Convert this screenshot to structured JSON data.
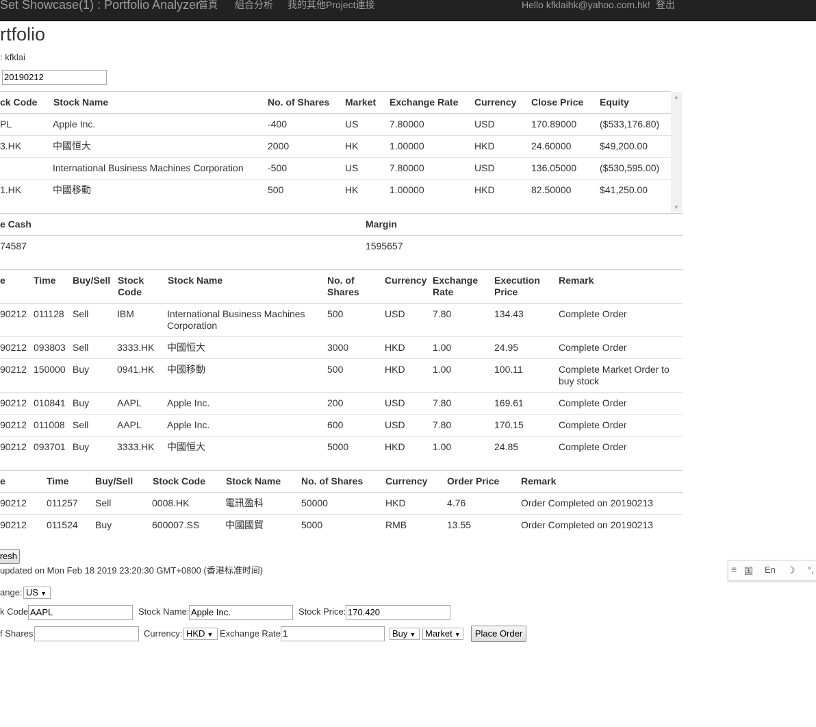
{
  "navbar": {
    "brand": "Set Showcase(1) : Portfolio Analyzer",
    "links": [
      "首頁",
      "組合分析",
      "我的其他Project連接"
    ],
    "user": "Hello kfklaihk@yahoo.com.hk!",
    "logout": "登出"
  },
  "page": {
    "title": "rtfolio",
    "user_line": ": kfklai",
    "date_value": "20190212"
  },
  "holdings": {
    "headers": [
      "ck Code",
      "Stock Name",
      "No. of Shares",
      "Market",
      "Exchange Rate",
      "Currency",
      "Close Price",
      "Equity"
    ],
    "rows": [
      [
        "PL",
        "Apple Inc.",
        "-400",
        "US",
        "7.80000",
        "USD",
        "170.89000",
        "($533,176.80)"
      ],
      [
        "3.HK",
        "中國恒大",
        "2000",
        "HK",
        "1.00000",
        "HKD",
        "24.60000",
        "$49,200.00"
      ],
      [
        "",
        "International Business Machines Corporation",
        "-500",
        "US",
        "7.80000",
        "USD",
        "136.05000",
        "($530,595.00)"
      ],
      [
        "1.HK",
        "中國移動",
        "500",
        "HK",
        "1.00000",
        "HKD",
        "82.50000",
        "$41,250.00"
      ]
    ]
  },
  "cash": {
    "headers": [
      "e Cash",
      "Margin"
    ],
    "values": [
      "74587",
      "1595657"
    ]
  },
  "transactions": {
    "headers": [
      "e",
      "Time",
      "Buy/Sell",
      "Stock Code",
      "Stock Name",
      "No. of Shares",
      "Currency",
      "Exchange Rate",
      "Execution Price",
      "Remark"
    ],
    "rows": [
      [
        "90212",
        "011128",
        "Sell",
        "IBM",
        "International Business Machines Corporation",
        "500",
        "USD",
        "7.80",
        "134.43",
        "Complete Order"
      ],
      [
        "90212",
        "093803",
        "Sell",
        "3333.HK",
        "中國恒大",
        "3000",
        "HKD",
        "1.00",
        "24.95",
        "Complete Order"
      ],
      [
        "90212",
        "150000",
        "Buy",
        "0941.HK",
        "中國移動",
        "500",
        "HKD",
        "1.00",
        "100.11",
        "Complete Market Order to buy stock"
      ],
      [
        "90212",
        "010841",
        "Buy",
        "AAPL",
        "Apple Inc.",
        "200",
        "USD",
        "7.80",
        "169.61",
        "Complete Order"
      ],
      [
        "90212",
        "011008",
        "Sell",
        "AAPL",
        "Apple Inc.",
        "600",
        "USD",
        "7.80",
        "170.15",
        "Complete Order"
      ],
      [
        "90212",
        "093701",
        "Buy",
        "3333.HK",
        "中國恒大",
        "5000",
        "HKD",
        "1.00",
        "24.85",
        "Complete Order"
      ]
    ]
  },
  "orders": {
    "headers": [
      "e",
      "Time",
      "Buy/Sell",
      "Stock Code",
      "Stock Name",
      "No. of Shares",
      "Currency",
      "Order Price",
      "Remark"
    ],
    "rows": [
      [
        "90212",
        "011257",
        "Sell",
        "0008.HK",
        "電訊盈科",
        "50000",
        "HKD",
        "4.76",
        "Order Completed on 20190213"
      ],
      [
        "90212",
        "011524",
        "Buy",
        "600007.SS",
        "中國國貿",
        "5000",
        "RMB",
        "13.55",
        "Order Completed on 20190213"
      ]
    ]
  },
  "refresh": {
    "button": "resh",
    "updated": "updated on Mon Feb 18 2019 23:20:30 GMT+0800 (香港标准时间)"
  },
  "order_form": {
    "exchange_label": "ange:",
    "exchange_value": "US",
    "stock_code_label": "k Code:",
    "stock_code_value": "AAPL",
    "stock_name_label": "Stock Name:",
    "stock_name_value": "Apple Inc.",
    "stock_price_label": "Stock Price:",
    "stock_price_value": "170.420",
    "shares_label": "f Shares:",
    "shares_value": "",
    "currency_label": "Currency:",
    "currency_value": "HKD",
    "exchange_rate_label": "Exchange Rate:",
    "exchange_rate_value": "1",
    "side_value": "Buy",
    "order_type_value": "Market",
    "place_order": "Place Order"
  },
  "ime_toolbar": {
    "lang": "En",
    "punct": "°,"
  }
}
